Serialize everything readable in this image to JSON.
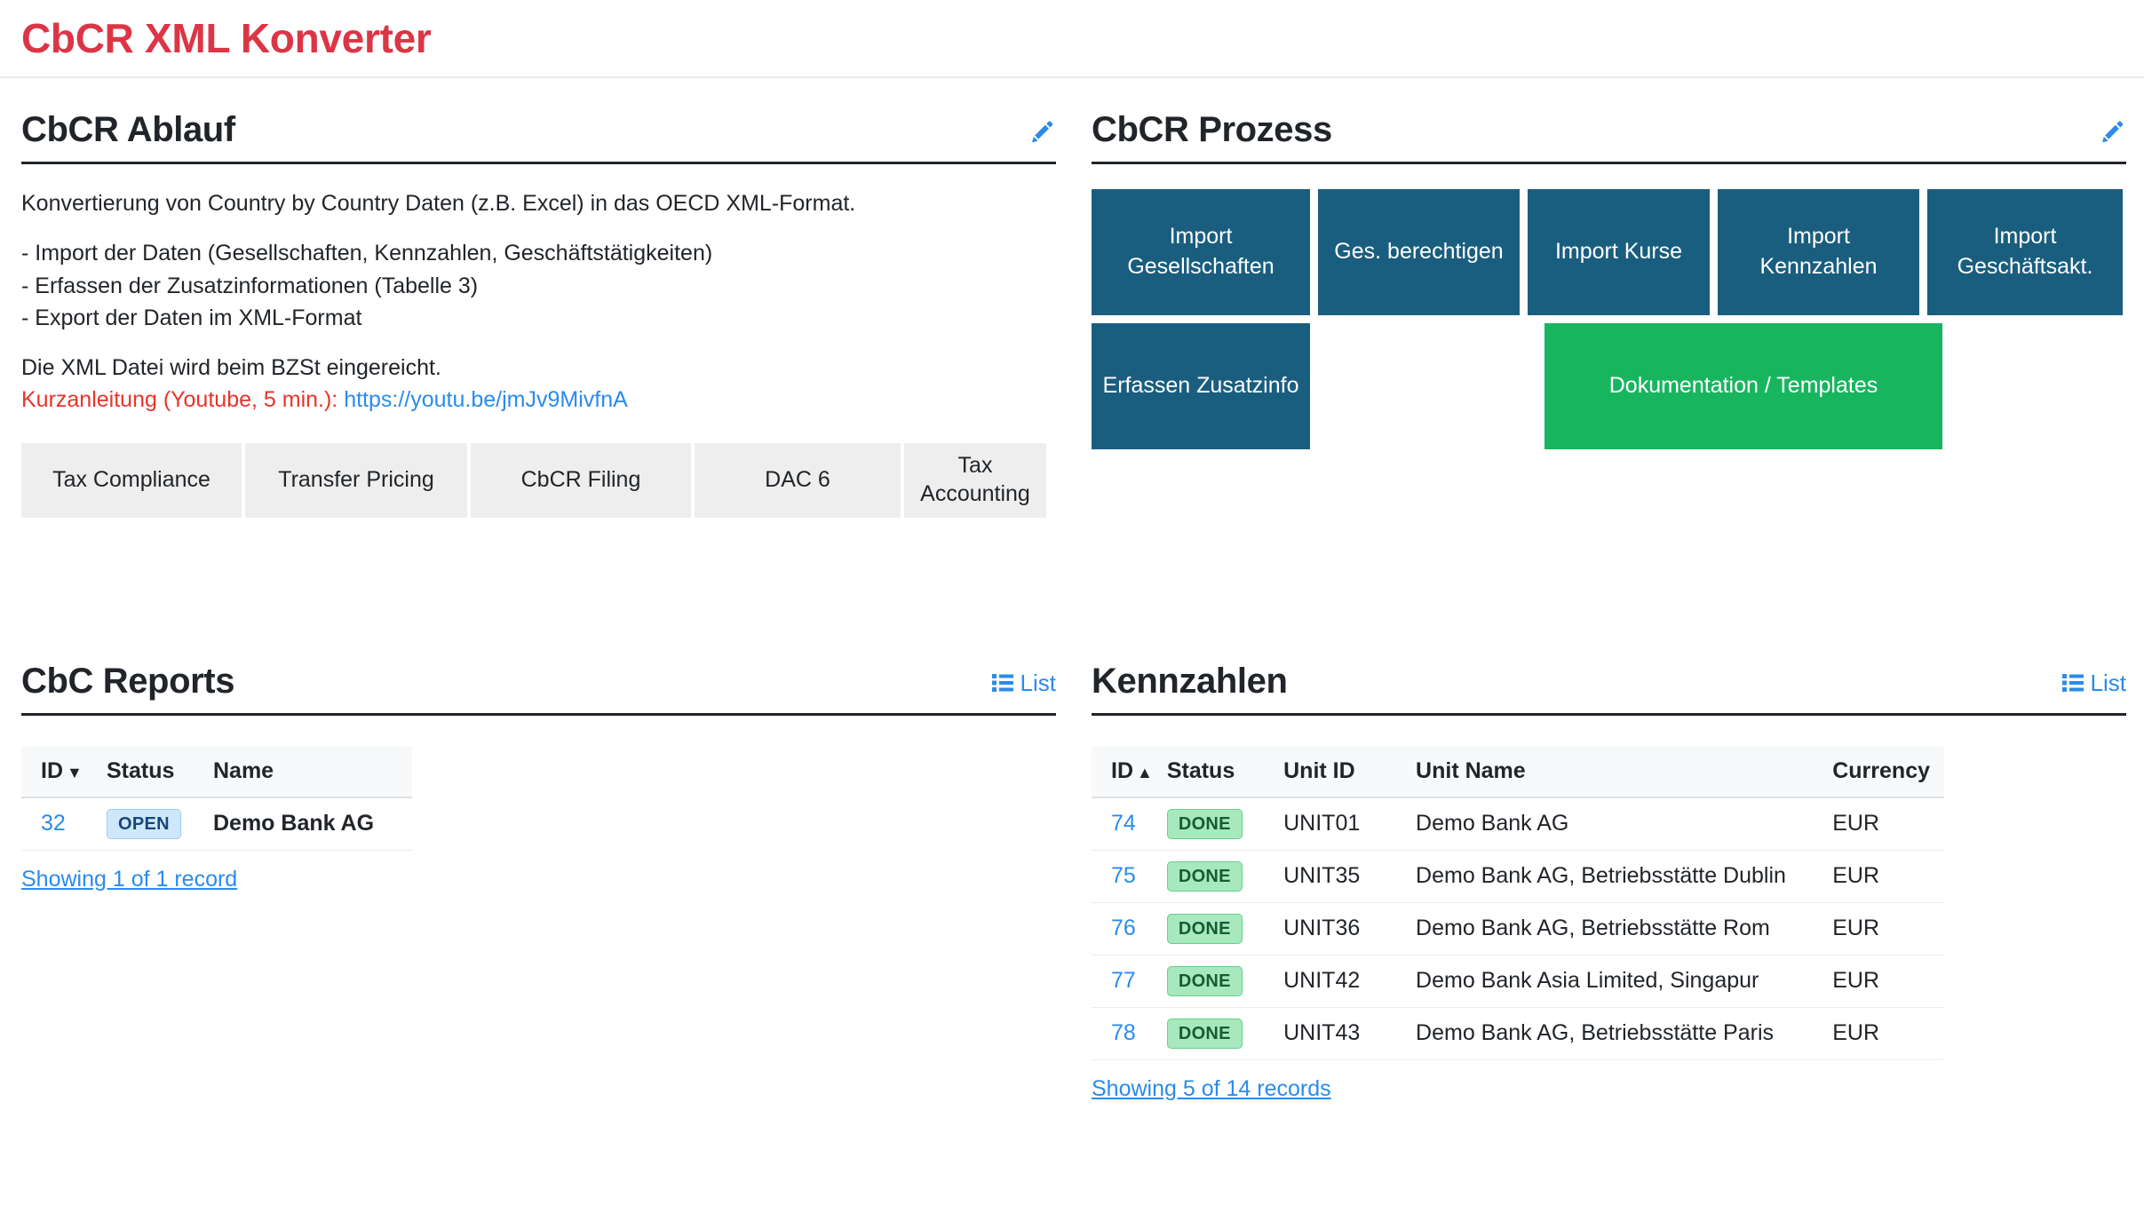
{
  "app": {
    "title": "CbCR XML Konverter",
    "accent_red": "#dc3545",
    "accent_blue": "#2b8bea",
    "tile_blue": "#1a5e7f",
    "tile_green": "#18b55f"
  },
  "ablauf": {
    "title": "CbCR Ablauf",
    "edit_icon": "pencil-icon",
    "intro": "Konvertierung von Country by Country Daten (z.B. Excel) in das OECD XML-Format.",
    "steps": [
      "- Import der Daten (Gesellschaften, Kennzahlen, Geschäftstätigkeiten)",
      "- Erfassen der Zusatzinformationen (Tabelle 3)",
      "- Export der Daten im XML-Format"
    ],
    "submit_note": "Die XML Datei wird beim BZSt eingereicht.",
    "guide_label": "Kurzanleitung (Youtube, 5 min.):",
    "guide_link": "https://youtu.be/jmJv9MivfnA",
    "tags": [
      "Tax Compliance",
      "Transfer Pricing",
      "CbCR Filing",
      "DAC 6",
      "Tax Accounting"
    ]
  },
  "prozess": {
    "title": "CbCR Prozess",
    "edit_icon": "pencil-icon",
    "row1": [
      "Import Gesellschaften",
      "Ges. berechtigen",
      "Import Kurse",
      "Import Kennzahlen",
      "Import Geschäftsakt."
    ],
    "row2": {
      "erfassen": "Erfassen Zusatzinfo",
      "dokumentation": "Dokumentation / Templates"
    }
  },
  "reports": {
    "title": "CbC Reports",
    "list_label": "List",
    "list_icon": "list-icon",
    "columns": [
      "ID",
      "Status",
      "Name"
    ],
    "sort_column": "ID",
    "sort_direction": "desc",
    "rows": [
      {
        "id": "32",
        "status": "OPEN",
        "name": "Demo Bank AG"
      }
    ],
    "footer": "Showing 1 of 1 record"
  },
  "kennzahlen": {
    "title": "Kennzahlen",
    "list_label": "List",
    "list_icon": "list-icon",
    "columns": [
      "ID",
      "Status",
      "Unit ID",
      "Unit Name",
      "Currency"
    ],
    "sort_column": "ID",
    "sort_direction": "asc",
    "rows": [
      {
        "id": "74",
        "status": "DONE",
        "unit_id": "UNIT01",
        "unit_name": "Demo Bank AG",
        "currency": "EUR"
      },
      {
        "id": "75",
        "status": "DONE",
        "unit_id": "UNIT35",
        "unit_name": "Demo Bank AG, Betriebsstätte Dublin",
        "currency": "EUR"
      },
      {
        "id": "76",
        "status": "DONE",
        "unit_id": "UNIT36",
        "unit_name": "Demo Bank AG, Betriebsstätte Rom",
        "currency": "EUR"
      },
      {
        "id": "77",
        "status": "DONE",
        "unit_id": "UNIT42",
        "unit_name": "Demo Bank Asia Limited, Singapur",
        "currency": "EUR"
      },
      {
        "id": "78",
        "status": "DONE",
        "unit_id": "UNIT43",
        "unit_name": "Demo Bank AG, Betriebsstätte Paris",
        "currency": "EUR"
      }
    ],
    "footer": "Showing 5 of 14 records"
  }
}
